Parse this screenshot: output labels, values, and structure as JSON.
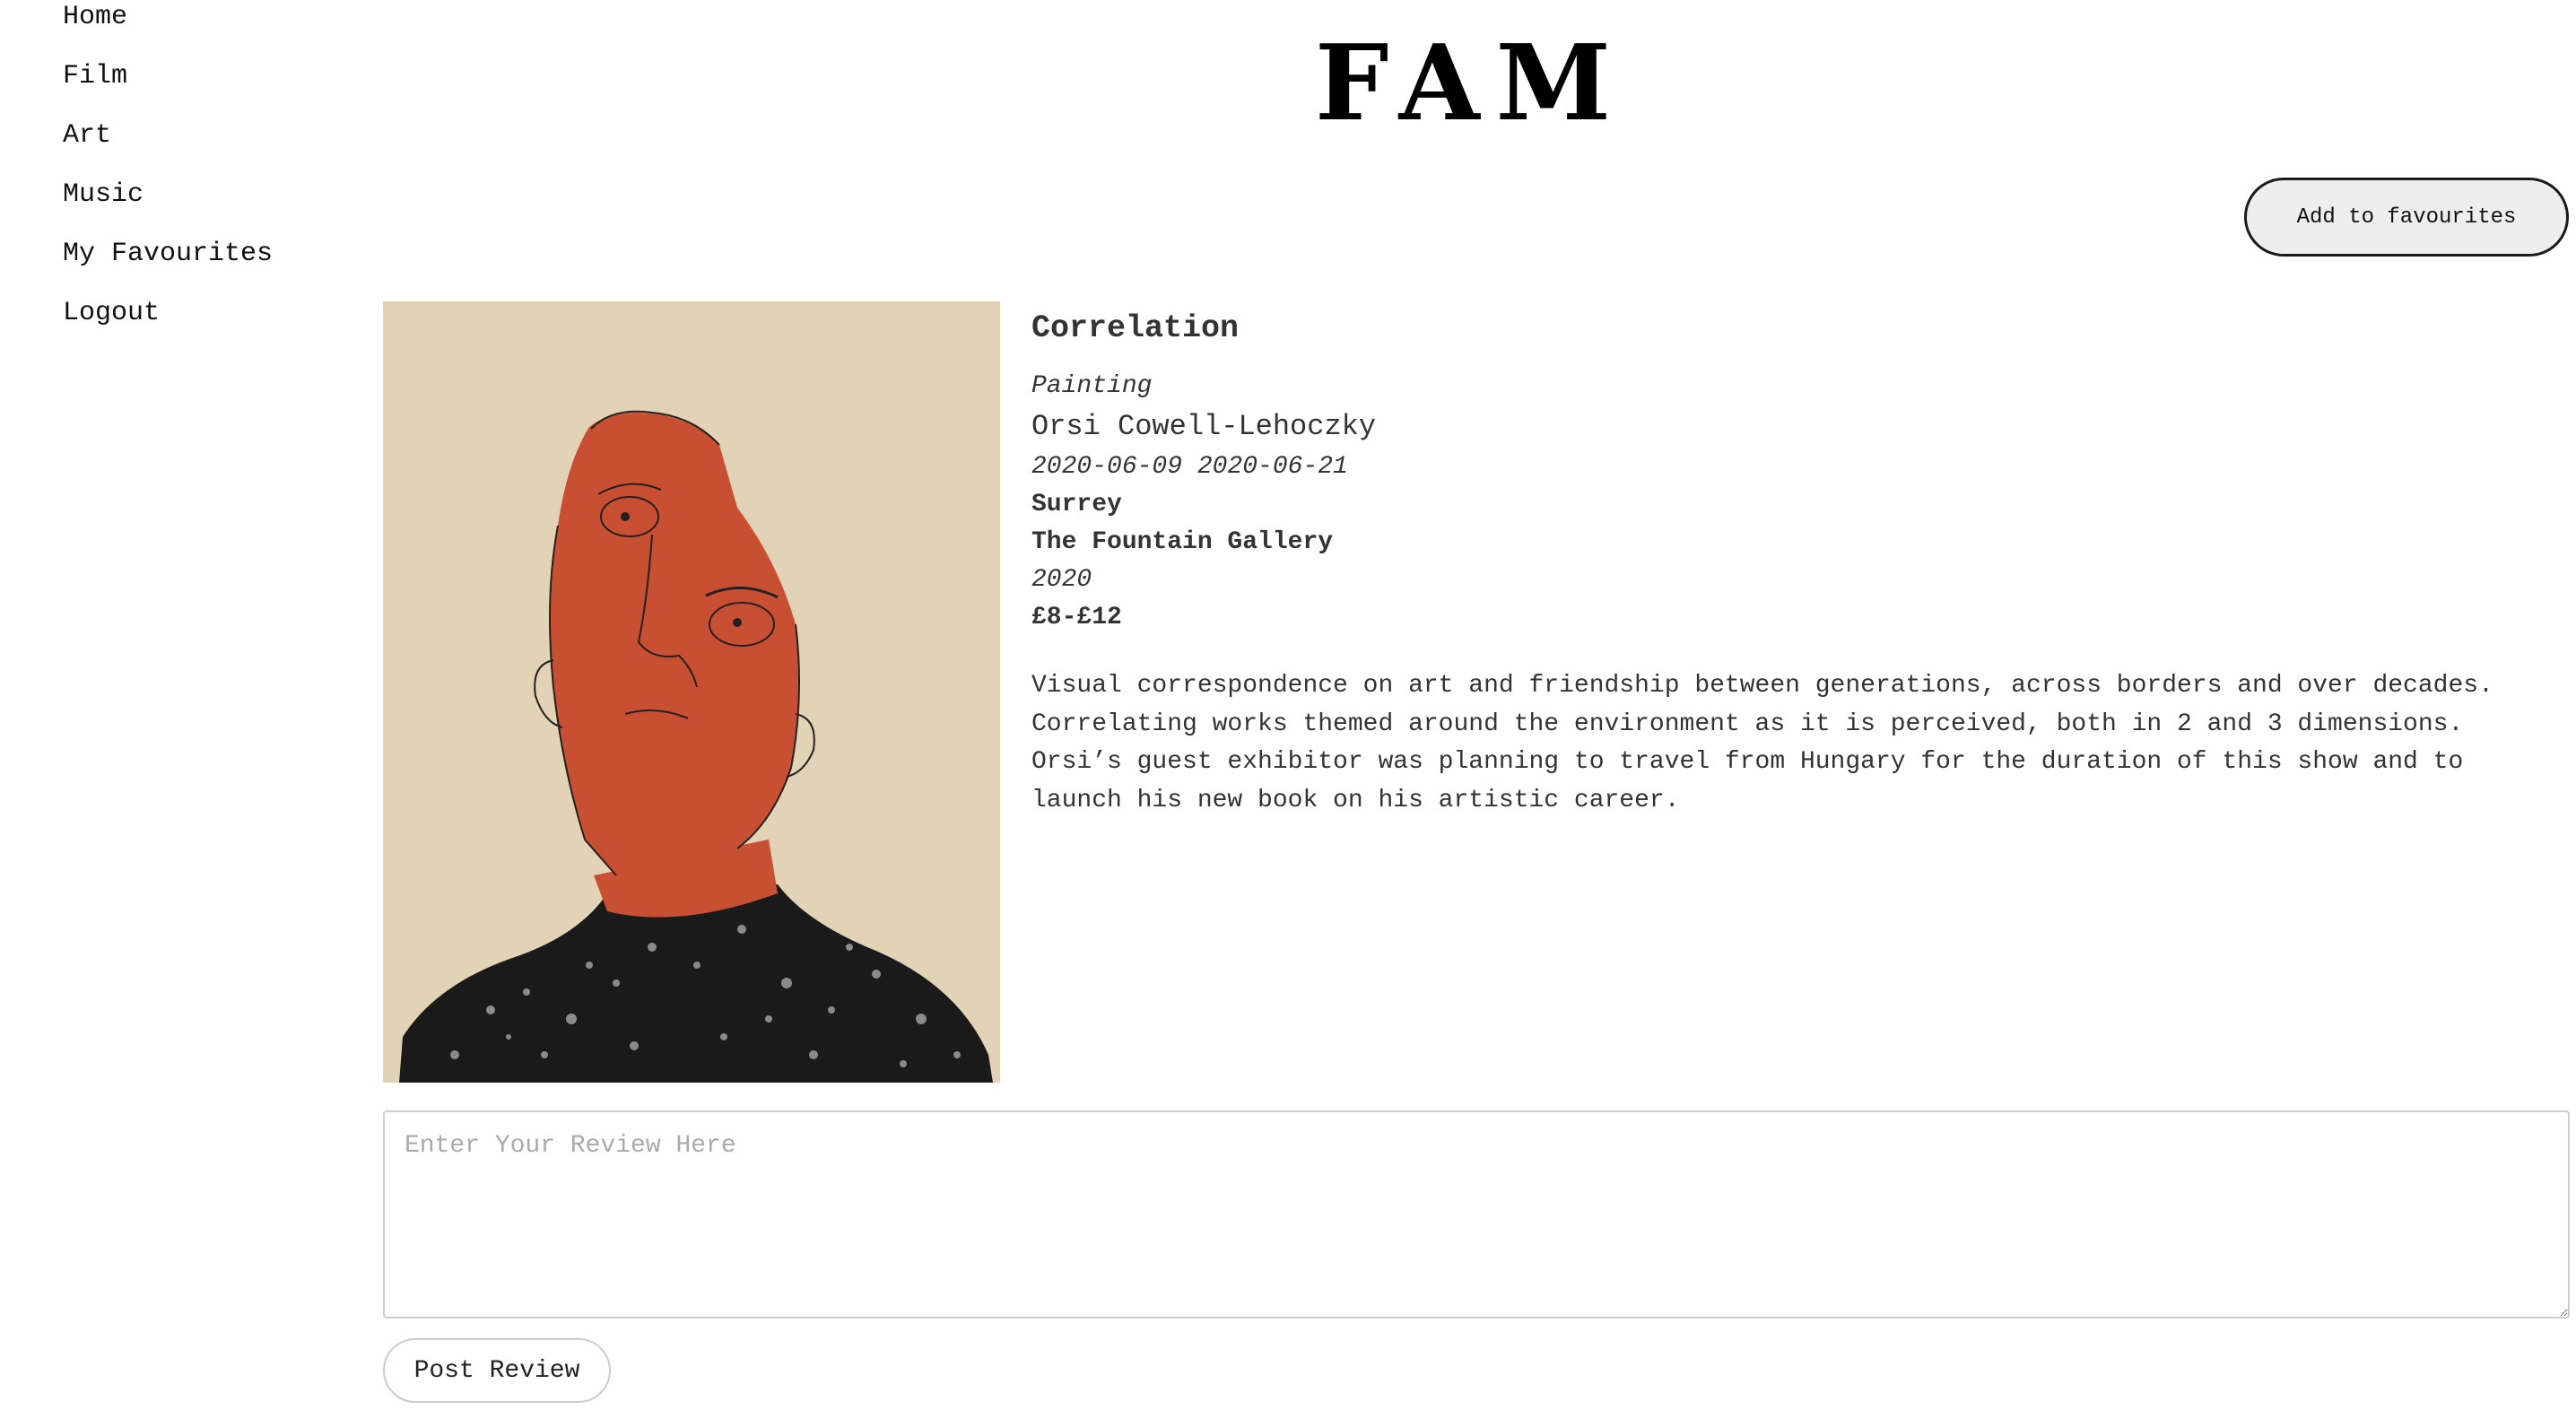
{
  "nav": {
    "items": [
      {
        "label": "Home"
      },
      {
        "label": "Film"
      },
      {
        "label": "Art"
      },
      {
        "label": "Music"
      },
      {
        "label": "My Favourites"
      },
      {
        "label": "Logout"
      }
    ]
  },
  "header": {
    "logo": "FAM"
  },
  "actions": {
    "add_favourites_label": "Add to favourites"
  },
  "event": {
    "title": "Correlation",
    "category": "Painting",
    "artist": "Orsi Cowell-Lehoczky",
    "dates": "2020-06-09 2020-06-21",
    "region": "Surrey",
    "venue": "The Fountain Gallery",
    "year": "2020",
    "price": "£8-£12",
    "description": "Visual correspondence on art and friendship between generations, across borders and over decades. Correlating works themed around the environment as it is perceived, both in 2 and 3 dimensions. Orsi’s guest exhibitor was planning to travel from Hungary for the duration of this show and to launch his new book on his artistic career."
  },
  "review": {
    "placeholder": "Enter Your Review Here",
    "value": "",
    "post_label": "Post Review"
  },
  "colors": {
    "image_background": "#e2d3b6",
    "face": "#c94f32",
    "button_background": "#eeeeee"
  }
}
